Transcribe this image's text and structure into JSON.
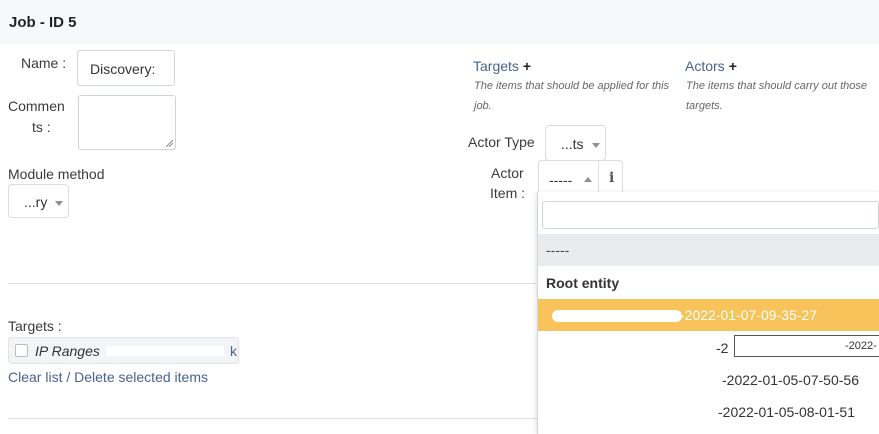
{
  "header": {
    "title": "Job - ID 5"
  },
  "form": {
    "name_label": "Name :",
    "name_value": "Discovery:",
    "comments_label_1": "Commen",
    "comments_label_2": "ts :",
    "module_method_label": "Module method",
    "module_method_value": "...ry"
  },
  "targets_panel": {
    "title": "Targets",
    "help": "The items that should be applied for this job."
  },
  "actors_panel": {
    "title": "Actors",
    "help": "The items that should carry out those targets.",
    "actor_type_label": "Actor Type",
    "actor_type_value": "...ts",
    "actor_item_label_1": "Actor",
    "actor_item_label_2": "Item :",
    "actor_item_value": "-----",
    "info_icon_glyph": "i"
  },
  "dropdown": {
    "search_value": "",
    "options": [
      {
        "text": "-----",
        "type": "blank"
      },
      {
        "text": "Root entity",
        "type": "group"
      },
      {
        "text": "-2022-01-07-09-35-27",
        "type": "highlighted"
      },
      {
        "text": "-2",
        "suffix": "-2022-",
        "type": "row"
      },
      {
        "text": "-2022-01-05-07-50-56",
        "type": "row"
      },
      {
        "text": "-2022-01-05-08-01-51",
        "type": "row"
      }
    ]
  },
  "targets_list": {
    "label": "Targets :",
    "item_label": "IP Ranges",
    "item_suffix": "k",
    "clear_label": "Clear list",
    "separator": "/",
    "delete_label": "Delete selected items"
  },
  "colors": {
    "highlight": "#f7c35a",
    "header_bg": "#f7f8fa",
    "link": "#4a6192"
  }
}
